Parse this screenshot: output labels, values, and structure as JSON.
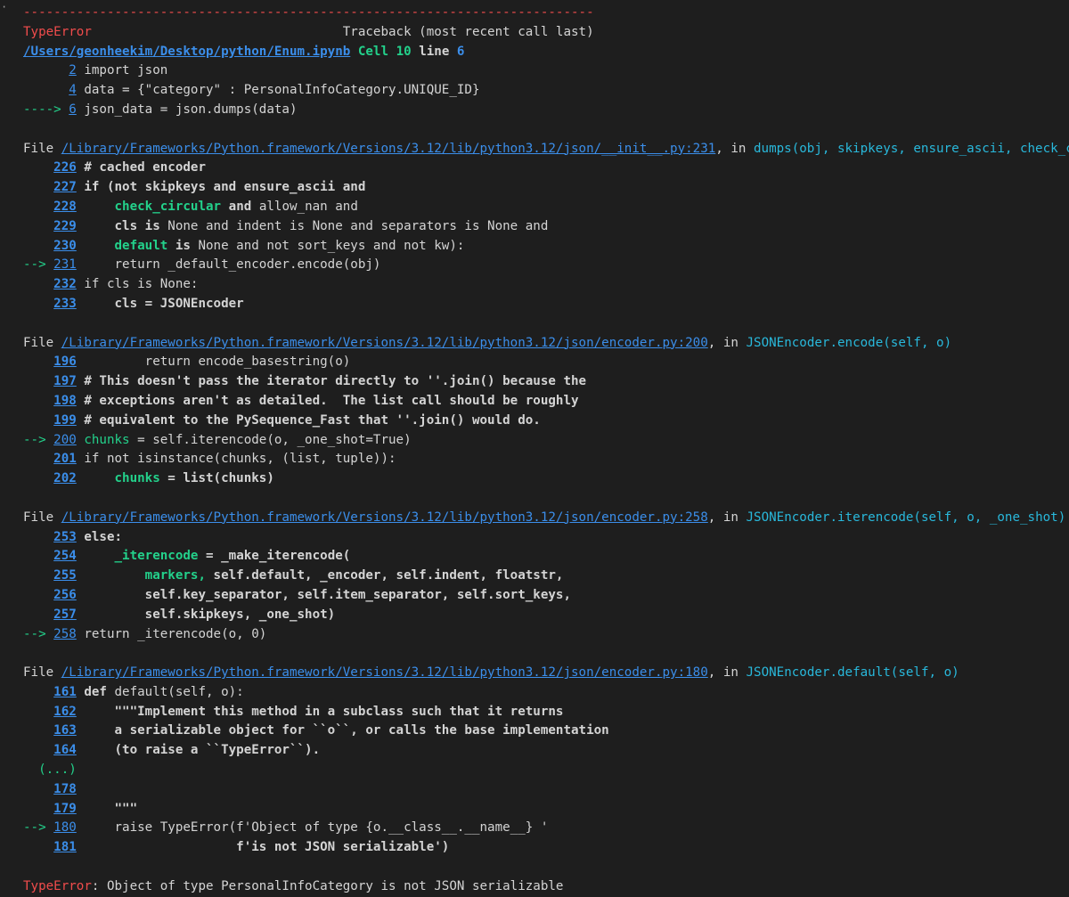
{
  "bullet": "·",
  "separator": "---------------------------------------------------------------------------",
  "header": {
    "error_name": "TypeError",
    "spacer": "                                 ",
    "traceback_label": "Traceback (most recent call last)"
  },
  "cell_ref": {
    "path": "/Users/geonheekim/Desktop/python/Enum.ipynb",
    "cell": "Cell",
    "cell_num": "10",
    "line_word": "line",
    "line_num": "6"
  },
  "cell_lines": [
    {
      "pad": "      ",
      "num": "2",
      "code": " import json"
    },
    {
      "pad": "      ",
      "num": "4",
      "code": " data = {\"category\" : PersonalInfoCategory.UNIQUE_ID}"
    },
    {
      "arrow": "----> ",
      "num": "6",
      "code": " json_data = json.dumps(data)"
    }
  ],
  "frames": [
    {
      "file_label": "File ",
      "path": "/Library/Frameworks/Python.framework/Versions/3.12/lib/python3.12/json/__init__.py:231",
      "in_text": ", in ",
      "func": "dumps(obj, skipkeys, ensure_ascii, check_circular, allow_nan, cls, indent, separators, default, sort_keys, **kw)"
    },
    {
      "file_label": "File ",
      "path": "/Library/Frameworks/Python.framework/Versions/3.12/lib/python3.12/json/encoder.py:200",
      "in_text": ", in ",
      "func": "JSONEncoder.encode(self, o)"
    },
    {
      "file_label": "File ",
      "path": "/Library/Frameworks/Python.framework/Versions/3.12/lib/python3.12/json/encoder.py:258",
      "in_text": ", in ",
      "func": "JSONEncoder.iterencode(self, o, _one_shot)"
    },
    {
      "file_label": "File ",
      "path": "/Library/Frameworks/Python.framework/Versions/3.12/lib/python3.12/json/encoder.py:180",
      "in_text": ", in ",
      "func": "JSONEncoder.default(self, o)"
    }
  ],
  "f1": {
    "l226": {
      "num": "226",
      "code": " # cached encoder"
    },
    "l227": {
      "num": "227",
      "code": " if (not skipkeys and ensure_ascii and"
    },
    "l228": {
      "num": "228",
      "a": "     ",
      "g": "check_circular",
      "b": " and",
      "c": " allow_nan and"
    },
    "l229": {
      "num": "229",
      "a": "     ",
      "g": "cls",
      "b": " is",
      "c": " None and indent is None and separators is None and"
    },
    "l230": {
      "num": "230",
      "a": "     ",
      "g": "default",
      "b": " is",
      "c": " None and not sort_keys and not kw):"
    },
    "l231": {
      "arrow": "--> ",
      "num": "231",
      "code": "     return _default_encoder.encode(obj)"
    },
    "l232": {
      "num": "232",
      "code": " if cls is None:"
    },
    "l233": {
      "num": "233",
      "a": "     ",
      "g": "cls",
      "b": " = JSONEncoder"
    }
  },
  "f2": {
    "l196": {
      "num": "196",
      "code": "         return encode_basestring(o)"
    },
    "l197": {
      "num": "197",
      "code": " # This doesn't pass the iterator directly to ''.join() because the"
    },
    "l198": {
      "num": "198",
      "code": " # exceptions aren't as detailed.  The list call should be roughly"
    },
    "l199": {
      "num": "199",
      "code": " # equivalent to the PySequence_Fast that ''.join() would do."
    },
    "l200": {
      "arrow": "--> ",
      "num": "200",
      "g": " chunks",
      "code": " = self.iterencode(o, _one_shot=True)"
    },
    "l201": {
      "num": "201",
      "code": " if not isinstance(chunks, (list, tuple)):"
    },
    "l202": {
      "num": "202",
      "a": "     ",
      "g": "chunks",
      "b": " = list(chunks)"
    }
  },
  "f3": {
    "l253": {
      "num": "253",
      "b": " else:"
    },
    "l254": {
      "num": "254",
      "a": "     ",
      "g": "_iterencode",
      "b": " = _make_iterencode("
    },
    "l255": {
      "num": "255",
      "a": "         ",
      "g": "markers,",
      "b": " self.default, _encoder, self.indent, floatstr,"
    },
    "l256": {
      "num": "256",
      "b": "         self.key_separator, self.item_separator, self.sort_keys,"
    },
    "l257": {
      "num": "257",
      "b": "         self.skipkeys, _one_shot)"
    },
    "l258": {
      "arrow": "--> ",
      "num": "258",
      "code": " return _iterencode(o, 0)"
    }
  },
  "f4": {
    "l161": {
      "num": "161",
      "b": " def",
      "code": " default(self, o):"
    },
    "l162": {
      "num": "162",
      "b": "     \"\"\"Implement this method in a subclass such that it returns"
    },
    "l163": {
      "num": "163",
      "b": "     a serializable object for ``o``, or calls the base implementation"
    },
    "l164": {
      "num": "164",
      "b": "     (to raise a ``TypeError``)."
    },
    "ellipsis": "  (...)",
    "l178": {
      "num": "178",
      "code": ""
    },
    "l179": {
      "num": "179",
      "b": "     \"\"\""
    },
    "l180": {
      "arrow": "--> ",
      "num": "180",
      "code": "     raise TypeError(f'Object of type {o.__class__.__name__} '"
    },
    "l181": {
      "num": "181",
      "b": "                     f'is not JSON serializable')"
    }
  },
  "final": {
    "error_name": "TypeError",
    "message": ": Object of type PersonalInfoCategory is not JSON serializable"
  }
}
